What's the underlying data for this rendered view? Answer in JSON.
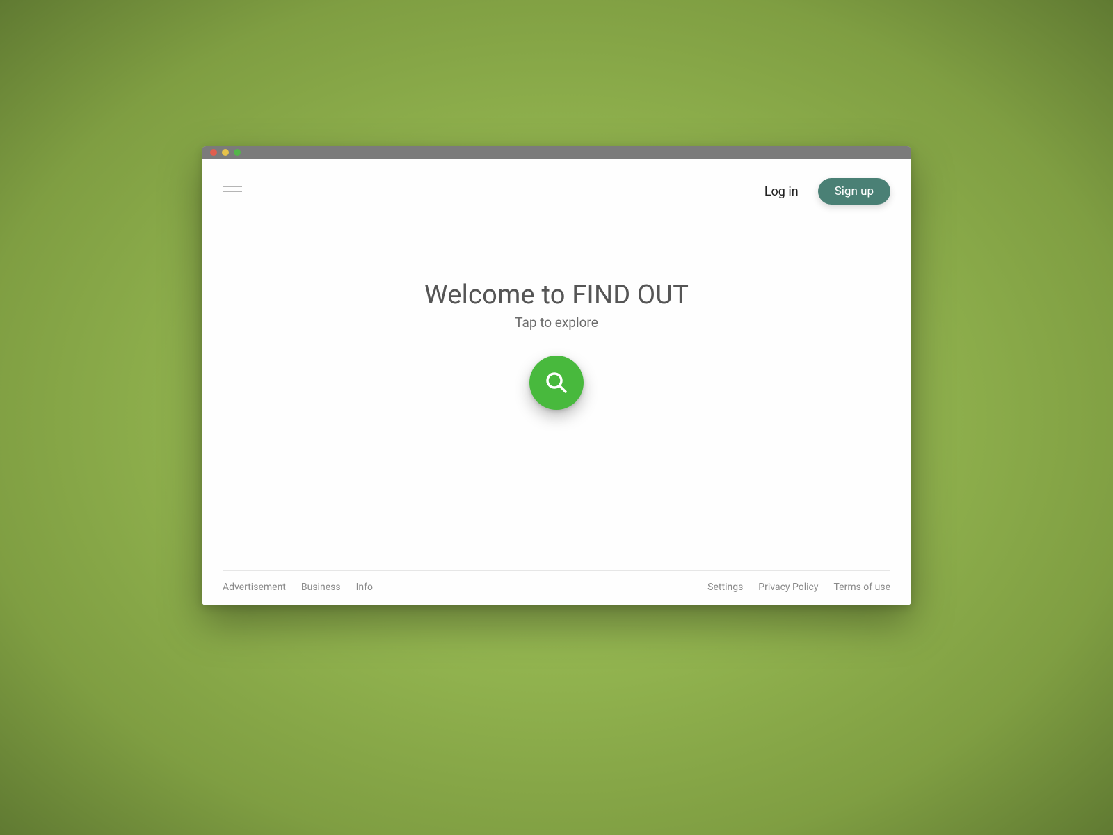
{
  "header": {
    "login_label": "Log in",
    "signup_label": "Sign up"
  },
  "hero": {
    "title": "Welcome to FIND OUT",
    "subtitle": "Tap to explore"
  },
  "footer": {
    "left": [
      "Advertisement",
      "Business",
      "Info"
    ],
    "right": [
      "Settings",
      "Privacy Policy",
      "Terms of use"
    ]
  }
}
